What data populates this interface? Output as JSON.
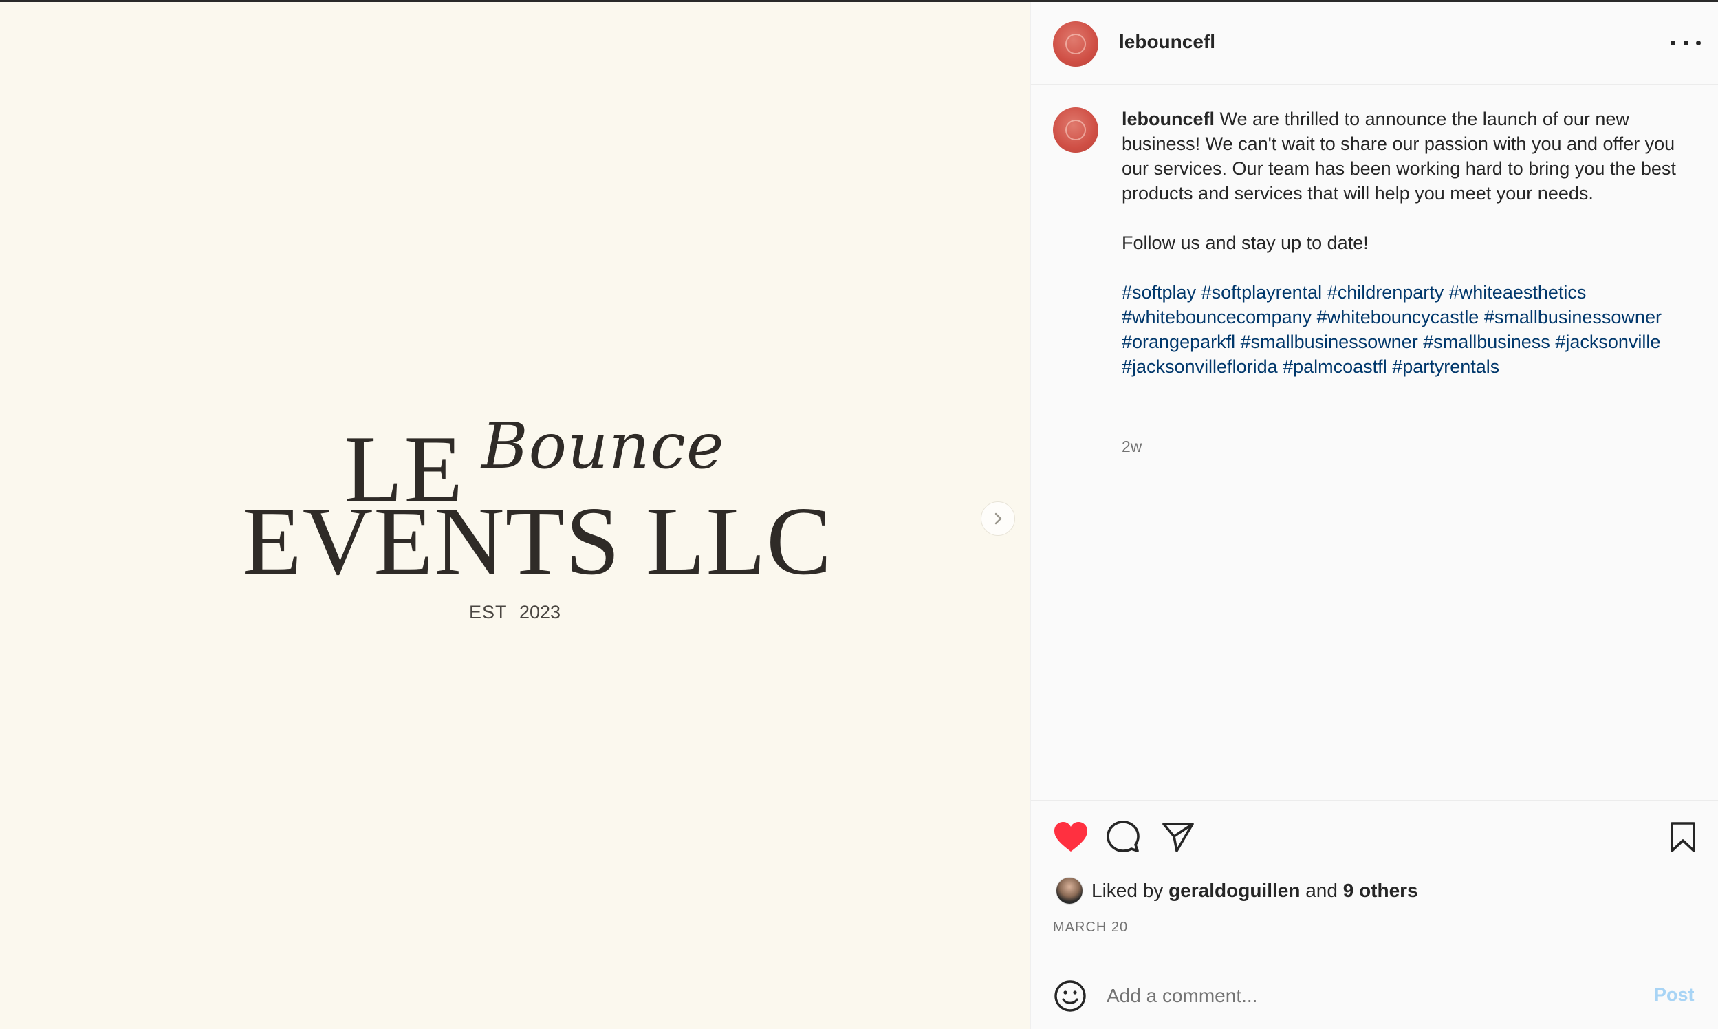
{
  "colors": {
    "media_bg": "#fbf8ee",
    "panel_bg": "#fafafa",
    "text": "#262626",
    "muted": "#737373",
    "hashtag": "#00376b",
    "like_red": "#ff3040",
    "post_disabled": "#a8d4f5",
    "avatar_red": "#cf4f45"
  },
  "media": {
    "logo_le": "LE",
    "logo_bounce": "Bounce",
    "logo_events": "EVENTS LLC",
    "logo_est": "EST",
    "logo_year": "2023",
    "next_icon": "chevron-right-icon"
  },
  "header": {
    "username": "lebouncefl",
    "more_icon": "more-horizontal-icon"
  },
  "caption": {
    "username": "lebouncefl",
    "paragraph1": "We are thrilled to announce the launch of our new business! We can't wait to share our passion with you and offer you our services. Our team has been working hard to bring you the best products and services that will help you meet your needs.",
    "paragraph2": "Follow us and stay up to date!",
    "hashtags": "#softplay #softplayrental #childrenparty #whiteaesthetics #whitebouncecompany #whitebouncycastle #smallbusinessowner #orangeparkfl #smallbusinessowner #smallbusiness #jacksonville #jacksonvilleflorida #palmcoastfl #partyrentals",
    "time": "2w"
  },
  "actions": {
    "like_icon": "heart-filled-icon",
    "comment_icon": "comment-icon",
    "share_icon": "send-icon",
    "save_icon": "bookmark-icon"
  },
  "likes": {
    "prefix": "Liked by",
    "user": "geraldoguillen",
    "connector": "and",
    "others": "9 others"
  },
  "date": "MARCH 20",
  "comment_box": {
    "placeholder": "Add a comment...",
    "post_label": "Post",
    "emoji_icon": "smiley-icon"
  }
}
